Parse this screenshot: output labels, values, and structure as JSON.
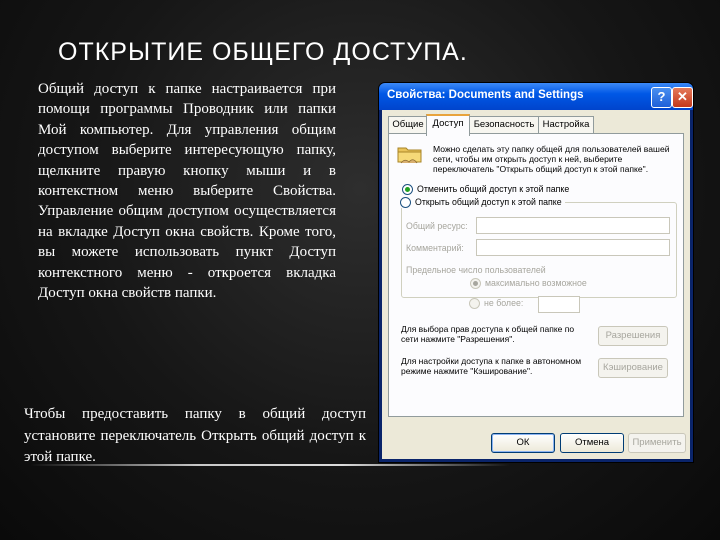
{
  "slide": {
    "title": "ОТКРЫТИЕ ОБЩЕГО ДОСТУПА.",
    "paragraph1": "Общий доступ к папке настраивается при помощи программы Проводник или папки Мой компьютер. Для управления общим доступом выберите интересующую папку, щелкните правую кнопку мыши и в контекстном меню выберите Свойства. Управление общим доступом осуществляется на вкладке Доступ окна свойств. Кроме того, вы можете использовать пункт Доступ контекстного меню - откроется вкладка Доступ окна свойств папки.",
    "paragraph2": "Чтобы предоставить папку в общий доступ установите переключатель Открыть общий доступ к этой папке."
  },
  "dialog": {
    "title": "Свойства: Documents and Settings",
    "help_label": "?",
    "close_label": "✕",
    "tabs": [
      {
        "label": "Общие"
      },
      {
        "label": "Доступ"
      },
      {
        "label": "Безопасность"
      },
      {
        "label": "Настройка"
      }
    ],
    "active_tab": "Доступ",
    "info": "Можно сделать эту папку общей для пользователей вашей сети, чтобы им открыть доступ к ней, выберите переключатель \"Открыть общий доступ к этой папке\".",
    "radio_no_share": "Отменить общий доступ к этой папке",
    "radio_share": "Открыть общий доступ к этой папке",
    "share_name_label": "Общий ресурс:",
    "comment_label": "Комментарий:",
    "limit_label": "Предельное число пользователей",
    "max_allowed_label": "максимально возможное",
    "no_more_label": "не более:",
    "permissions_desc": "Для выбора прав доступа к общей папке по сети нажмите \"Разрешения\".",
    "permissions_button": "Разрешения",
    "caching_desc": "Для настройки доступа к папке в автономном режиме нажмите \"Кэширование\".",
    "caching_button": "Кэширование",
    "ok_button": "ОК",
    "cancel_button": "Отмена",
    "apply_button": "Применить"
  },
  "colors": {
    "titlebar": "#0058e6",
    "dialog_face": "#ece9d8",
    "radio_accent": "#21a121",
    "tab_highlight": "#e8a33c"
  }
}
